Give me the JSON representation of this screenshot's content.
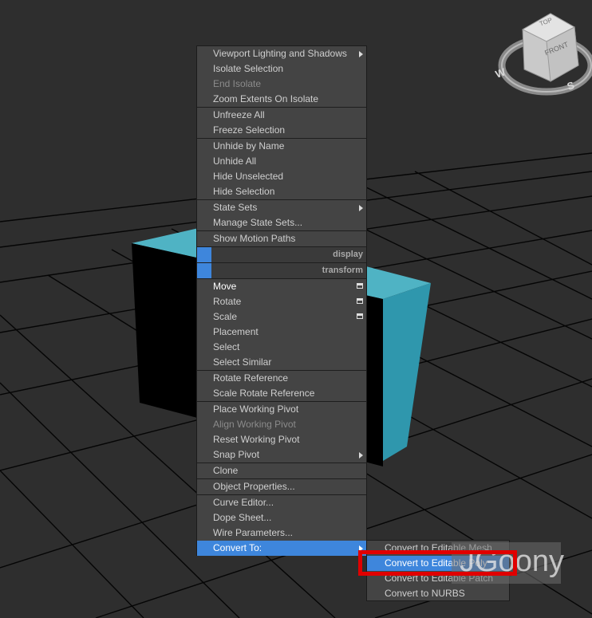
{
  "quad_menu": {
    "groups": [
      {
        "items": [
          {
            "label": "Viewport Lighting and Shadows",
            "submenu": true
          },
          {
            "label": "Isolate Selection"
          },
          {
            "label": "End Isolate",
            "disabled": true
          },
          {
            "label": "Zoom Extents On Isolate"
          }
        ]
      },
      {
        "items": [
          {
            "label": "Unfreeze All"
          },
          {
            "label": "Freeze Selection"
          }
        ]
      },
      {
        "items": [
          {
            "label": "Unhide by Name"
          },
          {
            "label": "Unhide All"
          },
          {
            "label": "Hide Unselected"
          },
          {
            "label": "Hide Selection"
          }
        ]
      },
      {
        "items": [
          {
            "label": "State Sets",
            "submenu": true
          },
          {
            "label": "Manage State Sets..."
          }
        ]
      },
      {
        "items": [
          {
            "label": "Show Motion Paths"
          }
        ]
      }
    ],
    "display_title": "display",
    "transform_title": "transform",
    "transform_groups": [
      {
        "items": [
          {
            "label": "Move",
            "options": true,
            "bold": true
          },
          {
            "label": "Rotate",
            "options": true
          },
          {
            "label": "Scale",
            "options": true
          },
          {
            "label": "Placement"
          },
          {
            "label": "Select"
          },
          {
            "label": "Select Similar"
          }
        ]
      },
      {
        "items": [
          {
            "label": "Rotate Reference"
          },
          {
            "label": "Scale Rotate Reference"
          }
        ]
      },
      {
        "items": [
          {
            "label": "Place Working Pivot"
          },
          {
            "label": "Align Working Pivot",
            "disabled": true
          },
          {
            "label": "Reset Working Pivot"
          },
          {
            "label": "Snap Pivot",
            "submenu": true
          }
        ]
      },
      {
        "items": [
          {
            "label": "Clone"
          }
        ]
      },
      {
        "items": [
          {
            "label": "Object Properties..."
          }
        ]
      },
      {
        "items": [
          {
            "label": "Curve Editor..."
          },
          {
            "label": "Dope Sheet..."
          },
          {
            "label": "Wire Parameters..."
          },
          {
            "label": "Convert To:",
            "submenu": true,
            "highlighted": true
          }
        ]
      }
    ]
  },
  "convert_submenu": {
    "items": [
      {
        "label": "Convert to Editable Mesh"
      },
      {
        "label": "Convert to Editable Poly",
        "highlighted": true
      },
      {
        "label": "Convert to Editable Patch"
      },
      {
        "label": "Convert to NURBS"
      }
    ]
  },
  "viewcube": {
    "top_label": "TOP",
    "front_label": "FRONT",
    "compass_w": "W",
    "compass_s": "S"
  },
  "watermark": "JGoony",
  "colors": {
    "menu_bg": "#444444",
    "highlight": "#3e86dc",
    "cube_top": "#4fb3c4",
    "cube_side": "#2f97ad",
    "annotation_red": "#e00000"
  }
}
